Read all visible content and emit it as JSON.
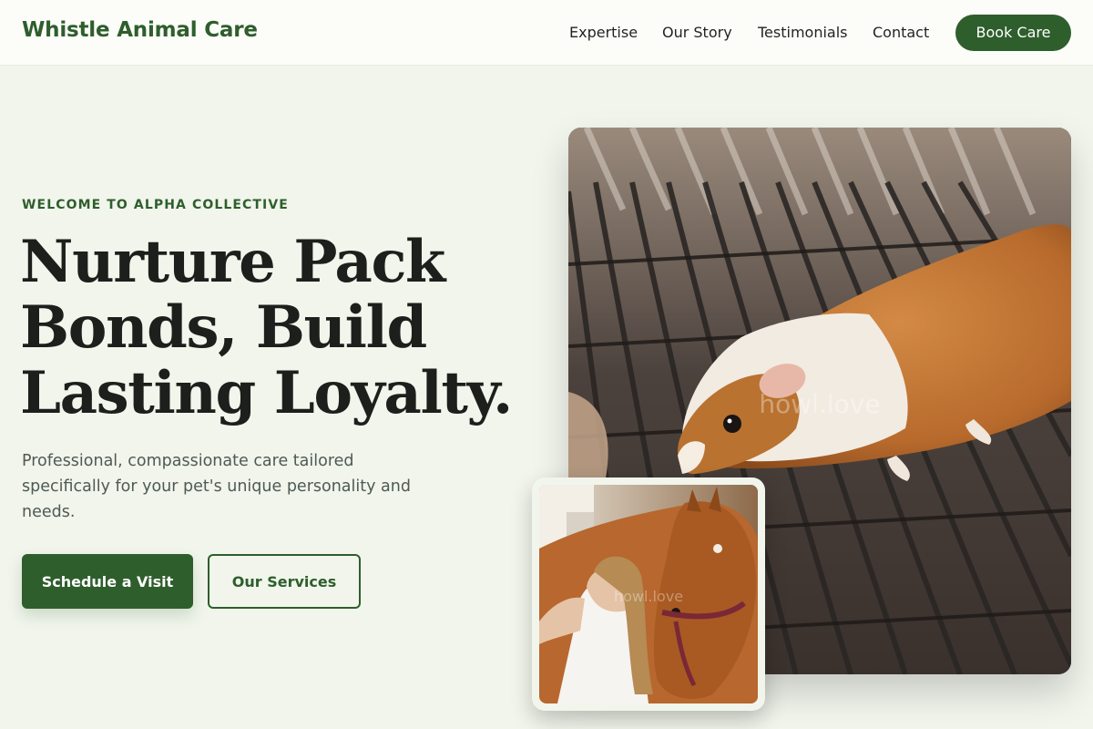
{
  "header": {
    "brand": "Whistle Animal Care",
    "nav": [
      "Expertise",
      "Our Story",
      "Testimonials",
      "Contact"
    ],
    "cta": "Book Care"
  },
  "hero": {
    "eyebrow": "WELCOME TO ALPHA COLLECTIVE",
    "headline_lines": [
      "Nurture Pack",
      "Bonds, Build",
      "Lasting Loyalty."
    ],
    "subtext": "Professional, compassionate care tailored specifically for your pet's unique personality and needs.",
    "primary_button": "Schedule a Visit",
    "secondary_button": "Our Services"
  },
  "images": {
    "main_watermark": "howl.love",
    "small_watermark": "howl.love"
  },
  "colors": {
    "brand": "#2e5e2c",
    "background": "#f1f5ec",
    "nav_background": "#fcfcf9"
  }
}
